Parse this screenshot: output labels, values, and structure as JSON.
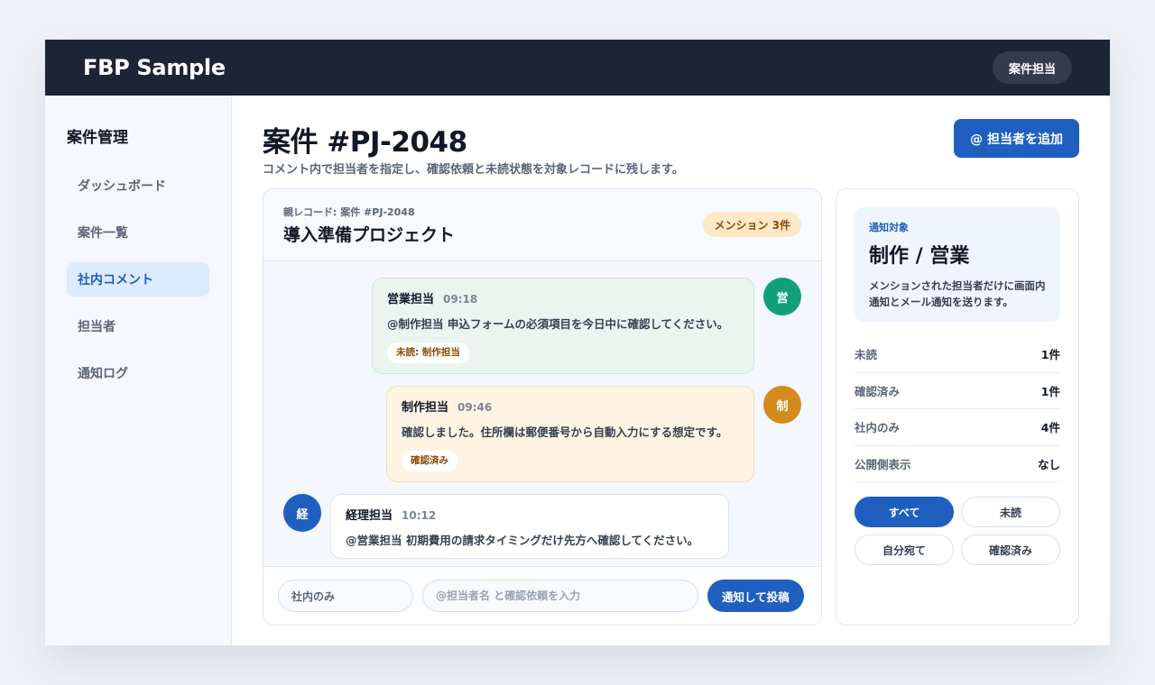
{
  "app": {
    "title": "FBP Sample",
    "role": "案件担当"
  },
  "sidebar": {
    "title": "案件管理",
    "items": [
      {
        "label": "ダッシュボード",
        "active": false
      },
      {
        "label": "案件一覧",
        "active": false
      },
      {
        "label": "社内コメント",
        "active": true
      },
      {
        "label": "担当者",
        "active": false
      },
      {
        "label": "通知ログ",
        "active": false
      }
    ]
  },
  "page": {
    "title": "案件 #PJ-2048",
    "subtitle": "コメント内で担当者を指定し、確認依頼と未読状態を対象レコードに残します。",
    "add_button": "@ 担当者を追加"
  },
  "thread": {
    "parent_label": "親レコード: 案件 #PJ-2048",
    "title": "導入準備プロジェクト",
    "mention_badge": "メンション 3件",
    "messages": [
      {
        "author": "営業担当",
        "time": "09:18",
        "text": "@制作担当 申込フォームの必須項目を今日中に確認してください。",
        "tag": "未読: 制作担当",
        "avatar": "営",
        "avatar_color": "#12a07a"
      },
      {
        "author": "制作担当",
        "time": "09:46",
        "text": "確認しました。住所欄は郵便番号から自動入力にする想定です。",
        "tag": "確認済み",
        "avatar": "制",
        "avatar_color": "#d48a1c"
      },
      {
        "author": "経理担当",
        "time": "10:12",
        "text": "@営業担当 初期費用の請求タイミングだけ先方へ確認してください。",
        "avatar": "経",
        "avatar_color": "#1f5fbf"
      }
    ],
    "composer": {
      "scope": "社内のみ",
      "placeholder": "@担当者名 と確認依頼を入力",
      "post_button": "通知して投稿"
    }
  },
  "panel": {
    "target_label": "通知対象",
    "target_title": "制作 / 営業",
    "target_desc": "メンションされた担当者だけに画面内通知とメール通知を送ります。",
    "stats": [
      {
        "label": "未読",
        "value": "1件"
      },
      {
        "label": "確認済み",
        "value": "1件"
      },
      {
        "label": "社内のみ",
        "value": "4件"
      },
      {
        "label": "公開側表示",
        "value": "なし"
      }
    ],
    "filters": [
      {
        "label": "すべて",
        "active": true
      },
      {
        "label": "未読",
        "active": false
      },
      {
        "label": "自分宛て",
        "active": false
      },
      {
        "label": "確認済み",
        "active": false
      }
    ]
  }
}
